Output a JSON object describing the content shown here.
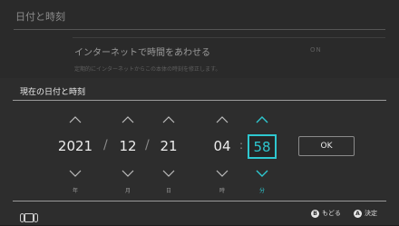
{
  "background": {
    "title": "日付と時刻",
    "setting_label": "インターネットで時間をあわせる",
    "setting_value": "ON",
    "setting_description": "定期的にインターネットからこの本体の時刻を修正します。"
  },
  "dialog": {
    "title": "現在の日付と時刻",
    "fields": {
      "year": {
        "value": "2021",
        "unit": "年"
      },
      "month": {
        "value": "12",
        "unit": "月"
      },
      "day": {
        "value": "21",
        "unit": "日"
      },
      "hour": {
        "value": "04",
        "unit": "時"
      },
      "minute": {
        "value": "58",
        "unit": "分"
      }
    },
    "date_separator": "/",
    "time_separator": ":",
    "ok_label": "OK"
  },
  "footer": {
    "back": {
      "glyph": "B",
      "label": "もどる"
    },
    "confirm": {
      "glyph": "A",
      "label": "決定"
    }
  },
  "colors": {
    "accent": "#2ec7cf",
    "background": "#2d2d2d",
    "text": "#ececec"
  },
  "icons": {
    "up": "chevron-up-icon",
    "down": "chevron-down-icon",
    "console": "console-icon"
  }
}
